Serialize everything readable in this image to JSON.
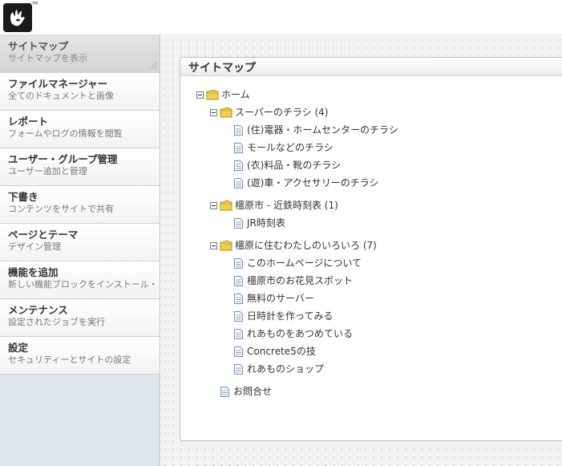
{
  "header": {
    "logo_icon": "concrete5-hand-logo",
    "logo_tm": "TM"
  },
  "sidebar": {
    "items": [
      {
        "title": "サイトマップ",
        "desc": "サイトマップを表示",
        "active": true
      },
      {
        "title": "ファイルマネージャー",
        "desc": "全てのドキュメントと画像"
      },
      {
        "title": "レポート",
        "desc": "フォームやログの情報を閲覧"
      },
      {
        "title": "ユーザー・グループ管理",
        "desc": "ユーザー追加と管理"
      },
      {
        "title": "下書き",
        "desc": "コンテンツをサイトで共有"
      },
      {
        "title": "ページとテーマ",
        "desc": "デザイン管理"
      },
      {
        "title": "機能を追加",
        "desc": "新しい機能ブロックをインストール・"
      },
      {
        "title": "メンテナンス",
        "desc": "設定されたジョブを実行"
      },
      {
        "title": "設定",
        "desc": "セキュリティーとサイトの設定"
      }
    ]
  },
  "panel": {
    "title": "サイトマップ"
  },
  "tree": {
    "home": "ホーム",
    "group1": {
      "label": "スーパーのチラシ (4)",
      "items": [
        "(住)電器・ホームセンターのチラシ",
        "モールなどのチラシ",
        "(衣)料品・靴のチラシ",
        "(遊)車・アクセサリーのチラシ"
      ]
    },
    "group2": {
      "label": "橿原市 - 近鉄時刻表 (1)",
      "items": [
        "JR時刻表"
      ]
    },
    "group3": {
      "label": "橿原に住むわたしのいろいろ (7)",
      "items": [
        "このホームページについて",
        "橿原市のお花見スポット",
        "無料のサーバー",
        "日時計を作ってみる",
        "れあものをあつめている",
        "Concrete5の技",
        "れあものショップ"
      ]
    },
    "contact": "お問合せ"
  },
  "colors": {
    "sidebar_bg": "#dce6ee",
    "folder_yellow": "#f2d04a",
    "page_icon_blue": "#6f8fb3"
  }
}
